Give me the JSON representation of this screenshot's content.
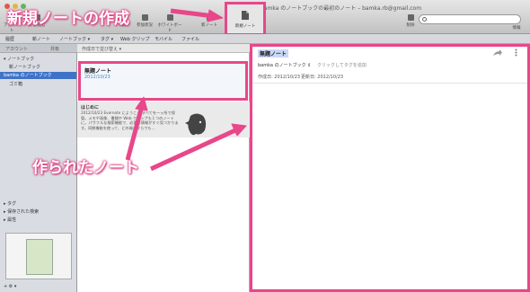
{
  "window": {
    "title": "bamka のノートブックの最初のノート – bamka.rb@gmail.com"
  },
  "toolbar": {
    "items": [
      {
        "label": "アカウント",
        "icon": "account-icon"
      },
      {
        "label": "戻る 進む",
        "icon": "back-forward-icon"
      },
      {
        "label": "同期",
        "icon": "sync-icon"
      },
      {
        "label": "参加状況",
        "icon": "activity-icon"
      },
      {
        "label": "ホワイトボード",
        "icon": "whiteboard-icon"
      },
      {
        "label": "新ノート",
        "icon": "new-note-icon"
      }
    ],
    "delete_label": "削除",
    "info_label": "情報",
    "new_note_label": "新規ノート"
  },
  "subbar": {
    "items": [
      "履歴",
      "新ノート",
      "ノートブック ▾",
      "タグ ▾",
      "Web クリップ",
      "モバイル",
      "ファイル"
    ]
  },
  "sidebar": {
    "tabs": [
      "アカウント",
      "共有"
    ],
    "sections": [
      {
        "label": "▾ ノートブック"
      },
      {
        "label": "bamka のノートブック",
        "selected": true
      },
      {
        "label": "新ノートブック"
      },
      {
        "label": "ゴミ箱"
      }
    ],
    "bottom_sections": [
      "▸ タグ",
      "▸ 保存された検索",
      "▸ 属性"
    ],
    "bottom_toolbar": "+  ⚙ ▾"
  },
  "note_list": {
    "sort_label": "作成日で並び替え ▾",
    "notes": [
      {
        "title": "無題ノート",
        "date": "2012/10/23"
      },
      {
        "title": "はじめに",
        "snippet": "2012/10/23 Evernote にようこそ すべてを一ヶ所で保管。メモや画像、書類や Web クリップも１つのノートに。パワフルな検索機能で、必要な情報がすぐ見つかります。同期機能を使って、どの端末からでも…"
      }
    ]
  },
  "editor": {
    "title": "無題ノート",
    "notebook": "bamka のノートブック ⇕",
    "tag_placeholder": "クリックしてタグを追加",
    "created": "作成日: 2012/10/23",
    "updated": "更新日: 2012/10/23"
  },
  "annotations": {
    "top": "新規ノートの作成",
    "middle": "作られたノート",
    "color": "#e8478a"
  }
}
